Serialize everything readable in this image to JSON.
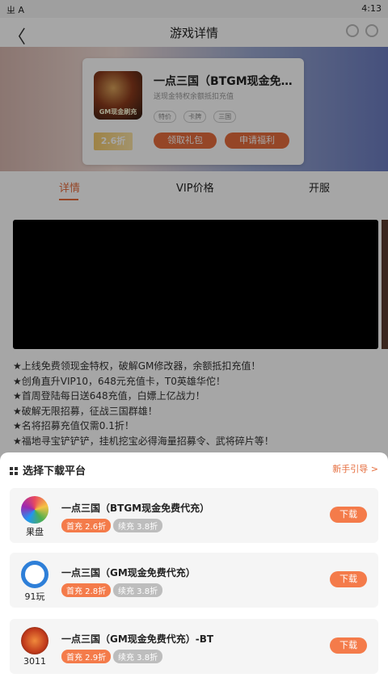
{
  "status": {
    "left_icons": "ㄓ A",
    "time": "4:13"
  },
  "appbar": {
    "title": "游戏详情",
    "back": "〈"
  },
  "game": {
    "name": "一点三国（BTGM现金免费代充）",
    "subtitle": "送现金特权余额抵扣充值",
    "tags": [
      "特价",
      "卡牌",
      "三国"
    ],
    "discount": "2.6折",
    "icon_text": "GM现金刷充",
    "btn_gift": "领取礼包",
    "btn_welfare": "申请福利"
  },
  "tabs": [
    {
      "label": "详情"
    },
    {
      "label": "VIP价格"
    },
    {
      "label": "开服"
    }
  ],
  "description": [
    "★上线免费领现金特权，破解GM修改器，余额抵扣充值！",
    "★创角直升VIP10，648元充值卡，T0英雄华佗！",
    "★首周登陆每日送648充值，白嫖上亿战力！",
    "★破解无限招募，征战三国群雄！",
    "★名将招募充值仅需0.1折！",
    "★福地寻宝铲铲铲，挂机挖宝必得海量招募令、武将碎片等！"
  ],
  "sheet": {
    "title": "选择下载平台",
    "guide": "新手引导 >",
    "platforms": [
      {
        "platform": "果盘",
        "game": "一点三国（BTGM现金免费代充）",
        "first": "首充 2.6折",
        "renew": "续充 3.8折",
        "download": "下载"
      },
      {
        "platform": "91玩",
        "game": "一点三国（GM现金免费代充）",
        "first": "首充 2.8折",
        "renew": "续充 3.8折",
        "download": "下载"
      },
      {
        "platform": "3011",
        "game": "一点三国（GM现金免费代充）-BT",
        "first": "首充 2.9折",
        "renew": "续充 3.8折",
        "download": "下载"
      }
    ]
  },
  "colors": {
    "accent": "#e56c3c",
    "badge": "#f47b4a"
  }
}
